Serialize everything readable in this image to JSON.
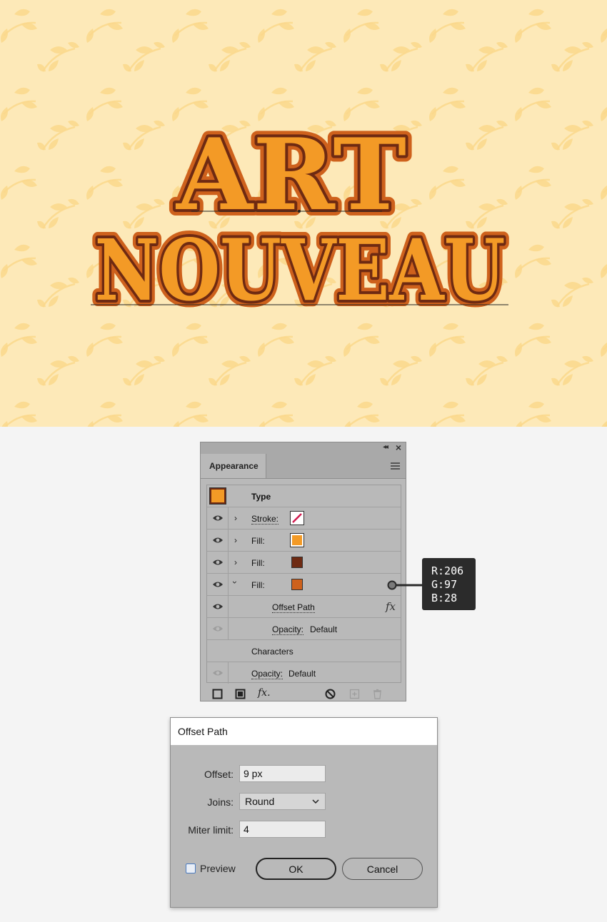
{
  "artwork": {
    "line1": "ART",
    "line2": "NOUVEAU",
    "colors": {
      "background": "#fde9b8",
      "pattern": "#fbd98c",
      "fill": "#f39a26",
      "inner_stroke": "#6e2a12",
      "offset_fill": "#ce611c"
    }
  },
  "appearance_panel": {
    "title": "Appearance",
    "collapse_icon": "double-chevron-left-icon",
    "close_icon": "close-icon",
    "rows": [
      {
        "label": "Type",
        "swatch": "#f39a26"
      },
      {
        "label": "Stroke:",
        "swatch": "none-red-slash"
      },
      {
        "label": "Fill:",
        "swatch": "#f39a26"
      },
      {
        "label": "Fill:",
        "swatch": "#6e2a12"
      },
      {
        "label": "Fill:",
        "swatch": "#ce611c"
      },
      {
        "label": "Offset Path",
        "fx": "fx"
      },
      {
        "label": "Opacity:",
        "value": "Default"
      },
      {
        "label": "Characters"
      },
      {
        "label": "Opacity:",
        "value": "Default"
      }
    ],
    "bottom_icons": [
      "stroke-icon",
      "fill-icon",
      "fx-menu-icon",
      "clear-icon",
      "duplicate-icon",
      "delete-icon"
    ],
    "fx_label": "fx."
  },
  "tooltip": {
    "r": "R:206",
    "g": "G:97",
    "b": "B:28"
  },
  "offset_dialog": {
    "title": "Offset Path",
    "offset_label": "Offset:",
    "offset_value": "9 px",
    "joins_label": "Joins:",
    "joins_value": "Round",
    "miter_label": "Miter limit:",
    "miter_value": "4",
    "preview_label": "Preview",
    "preview_checked": false,
    "ok_label": "OK",
    "cancel_label": "Cancel"
  }
}
